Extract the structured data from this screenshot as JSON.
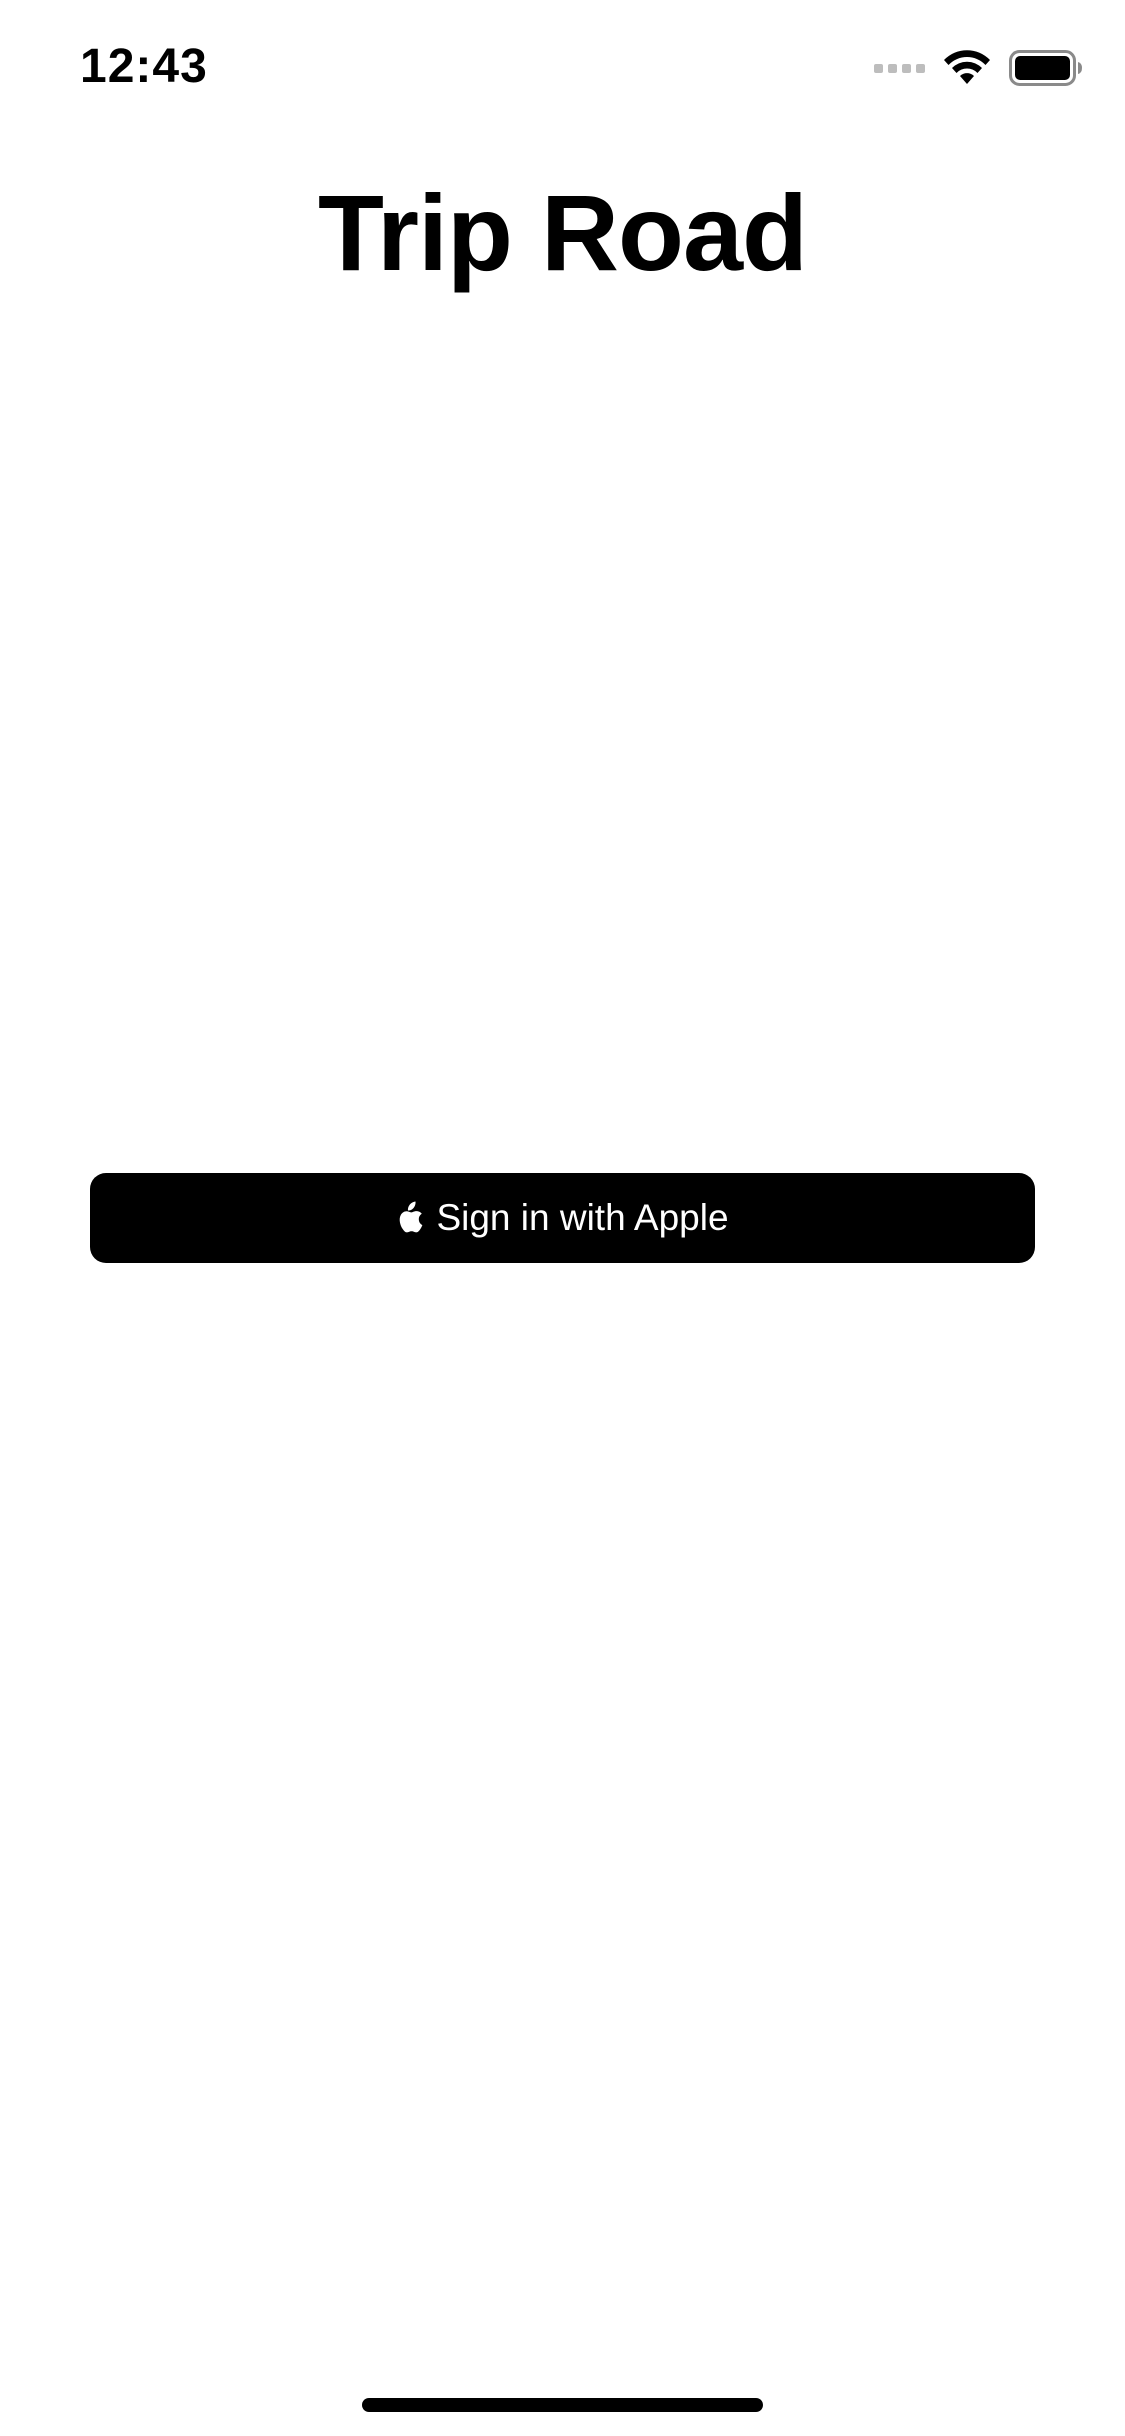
{
  "status_bar": {
    "time": "12:43",
    "icons": [
      "cellular-signal-icon",
      "wifi-icon",
      "battery-icon"
    ]
  },
  "app": {
    "title": "Trip Road"
  },
  "sign_in": {
    "button_label": "Sign in with Apple",
    "icon": "apple-logo-icon"
  },
  "colors": {
    "background": "#ffffff",
    "text": "#000000",
    "button_background": "#000000",
    "button_text": "#ffffff",
    "inactive_signal": "#bdbdbd"
  }
}
